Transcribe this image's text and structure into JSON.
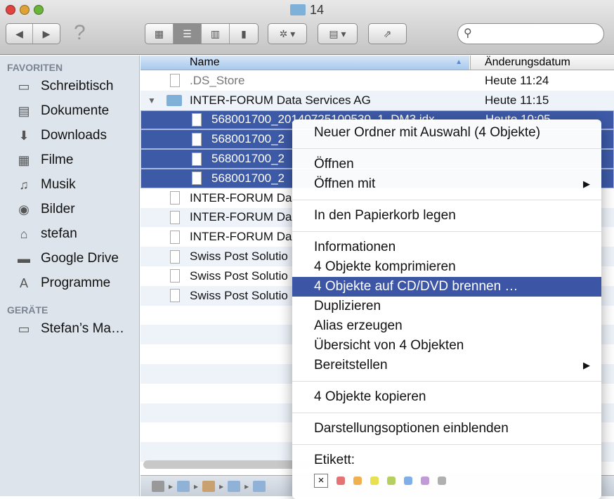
{
  "window": {
    "title": "14"
  },
  "toolbar": {
    "help": "?",
    "search_placeholder": ""
  },
  "sidebar": {
    "favorites_label": "FAVORITEN",
    "devices_label": "GERÄTE",
    "favorites": [
      {
        "label": "Schreibtisch",
        "icon": "desktop-icon"
      },
      {
        "label": "Dokumente",
        "icon": "documents-icon"
      },
      {
        "label": "Downloads",
        "icon": "downloads-icon"
      },
      {
        "label": "Filme",
        "icon": "movies-icon"
      },
      {
        "label": "Musik",
        "icon": "music-icon"
      },
      {
        "label": "Bilder",
        "icon": "pictures-icon"
      },
      {
        "label": "stefan",
        "icon": "home-icon"
      },
      {
        "label": "Google Drive",
        "icon": "folder-icon"
      },
      {
        "label": "Programme",
        "icon": "applications-icon"
      }
    ],
    "devices": [
      {
        "label": "Stefan’s Ma…",
        "icon": "laptop-icon"
      }
    ]
  },
  "columns": {
    "name": "Name",
    "date": "Änderungsdatum"
  },
  "files": [
    {
      "name": ".DS_Store",
      "date": "Heute 11:24"
    },
    {
      "name": "INTER-FORUM Data Services AG",
      "date": "Heute 11:15"
    },
    {
      "name": "568001700_20140725100530_1_DM3.idx",
      "date": "Heute 10:05"
    },
    {
      "name": "568001700_2",
      "date": ""
    },
    {
      "name": "568001700_2",
      "date": ""
    },
    {
      "name": "568001700_2",
      "date": ""
    },
    {
      "name": "INTER-FORUM Da",
      "date": ""
    },
    {
      "name": "INTER-FORUM Da",
      "date": ""
    },
    {
      "name": "INTER-FORUM Da",
      "date": ""
    },
    {
      "name": "Swiss Post Solutio",
      "date": ""
    },
    {
      "name": "Swiss Post Solutio",
      "date": ""
    },
    {
      "name": "Swiss Post Solutio",
      "date": ""
    }
  ],
  "menu": {
    "new_folder": "Neuer Ordner mit Auswahl (4 Objekte)",
    "open": "Öffnen",
    "open_with": "Öffnen mit",
    "trash": "In den Papierkorb legen",
    "info": "Informationen",
    "compress": "4 Objekte komprimieren",
    "burn": "4 Objekte auf CD/DVD brennen …",
    "duplicate": "Duplizieren",
    "alias": "Alias erzeugen",
    "overview": "Übersicht von 4 Objekten",
    "share": "Bereitstellen",
    "copy": "4 Objekte kopieren",
    "view_options": "Darstellungsoptionen einblenden",
    "label": "Etikett:",
    "label_none": "×",
    "label_colors": [
      "#e57373",
      "#f0b050",
      "#e8e050",
      "#b5d060",
      "#80aee8",
      "#c29ad8",
      "#b0b0b0"
    ]
  },
  "colors": {
    "selection": "#3d5aa7",
    "highlight": "#3d55a5"
  }
}
